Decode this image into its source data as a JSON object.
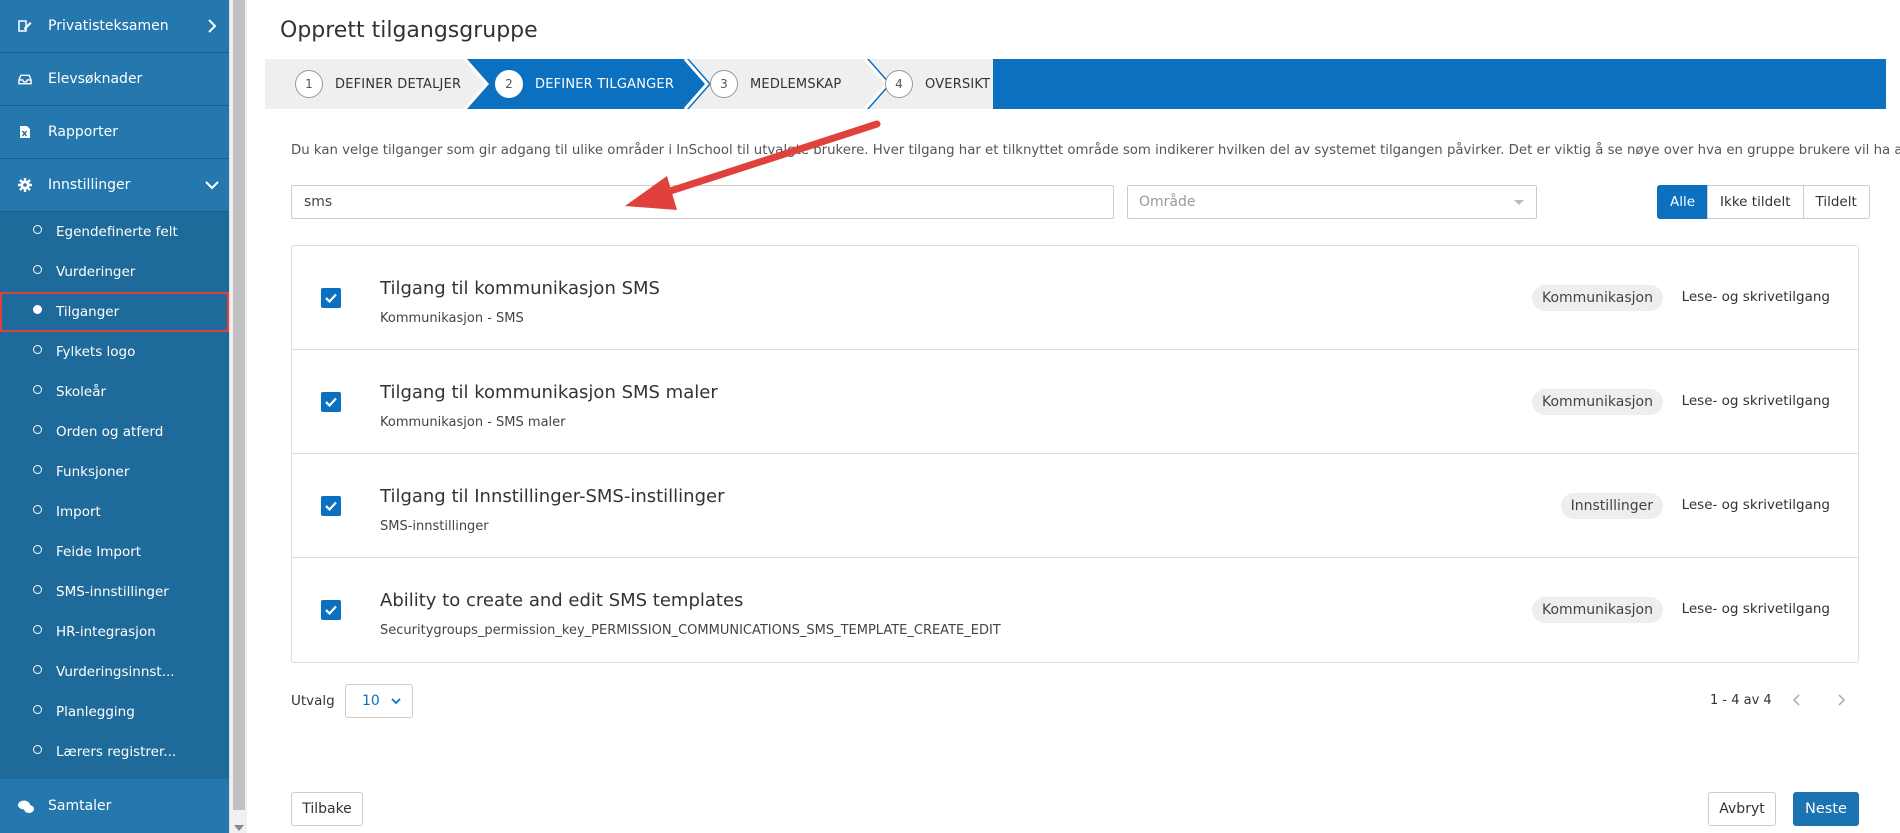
{
  "sidebar": {
    "top_items": [
      {
        "label": "Privatisteksamen",
        "icon": "pen-paper-icon"
      },
      {
        "label": "Elevsøknader",
        "icon": "inbox-icon"
      },
      {
        "label": "Rapporter",
        "icon": "excel-file-icon"
      },
      {
        "label": "Innstillinger",
        "icon": "gear-icon"
      }
    ],
    "sub_items": [
      {
        "label": "Egendefinerte felt"
      },
      {
        "label": "Vurderinger"
      },
      {
        "label": "Tilganger"
      },
      {
        "label": "Fylkets logo"
      },
      {
        "label": "Skoleår"
      },
      {
        "label": "Orden og atferd"
      },
      {
        "label": "Funksjoner"
      },
      {
        "label": "Import"
      },
      {
        "label": "Feide Import"
      },
      {
        "label": "SMS-innstillinger"
      },
      {
        "label": "HR-integrasjon"
      },
      {
        "label": "Vurderingsinnst..."
      },
      {
        "label": "Planlegging"
      },
      {
        "label": "Lærers registrer..."
      }
    ],
    "bottom_item": {
      "label": "Samtaler",
      "icon": "chat-bubbles-icon"
    },
    "active_sub_index": 2
  },
  "main": {
    "title": "Opprett tilgangsgruppe",
    "steps": [
      {
        "num": "1",
        "label": "DEFINER DETALJER"
      },
      {
        "num": "2",
        "label": "DEFINER TILGANGER"
      },
      {
        "num": "3",
        "label": "MEDLEMSKAP"
      },
      {
        "num": "4",
        "label": "OVERSIKT"
      }
    ],
    "active_step": 2,
    "intro": "Du kan velge tilganger som gir adgang til ulike områder i InSchool til utvalgte brukere. Hver tilgang har et tilknyttet område som indikerer hvilken del av systemet tilgangen påvirker. Det er viktig å se nøye over hva en gruppe brukere vil ha adgang til.",
    "search_value": "sms",
    "area_placeholder": "Område",
    "filters": [
      "Alle",
      "Ikke tildelt",
      "Tildelt"
    ],
    "active_filter": "Alle",
    "rows": [
      {
        "title": "Tilgang til kommunikasjon SMS",
        "subtitle": "Kommunikasjon - SMS",
        "tag": "Kommunikasjon",
        "access": "Lese- og skrivetilgang",
        "checked": true
      },
      {
        "title": "Tilgang til kommunikasjon SMS maler",
        "subtitle": "Kommunikasjon - SMS maler",
        "tag": "Kommunikasjon",
        "access": "Lese- og skrivetilgang",
        "checked": true
      },
      {
        "title": "Tilgang til Innstillinger-SMS-instillinger",
        "subtitle": "SMS-innstillinger",
        "tag": "Innstillinger",
        "access": "Lese- og skrivetilgang",
        "checked": true
      },
      {
        "title": "Ability to create and edit SMS templates",
        "subtitle": "Securitygroups_permission_key_PERMISSION_COMMUNICATIONS_SMS_TEMPLATE_CREATE_EDIT",
        "tag": "Kommunikasjon",
        "access": "Lese- og skrivetilgang",
        "checked": true
      }
    ],
    "utvalg_label": "Utvalg",
    "page_size": "10",
    "pager_info": "1 - 4 av 4",
    "back_label": "Tilbake",
    "cancel_label": "Avbryt",
    "next_label": "Neste"
  },
  "colors": {
    "sidebar_bg": "#1e6a9a",
    "sidebar_item_bg": "#2478ad",
    "primary": "#0c70c0",
    "annotation_red": "#e0413c"
  }
}
